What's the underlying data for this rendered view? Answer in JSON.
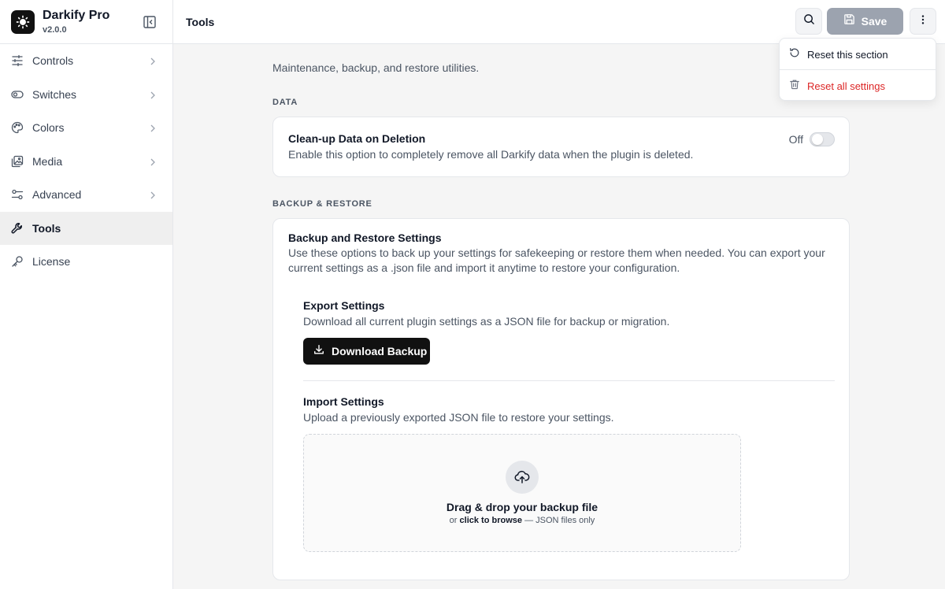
{
  "app": {
    "name": "Darkify Pro",
    "version": "v2.0.0"
  },
  "sidebar": {
    "items": [
      {
        "label": "Controls",
        "icon": "sliders-icon",
        "active": false
      },
      {
        "label": "Switches",
        "icon": "toggle-icon",
        "active": false
      },
      {
        "label": "Colors",
        "icon": "palette-icon",
        "active": false
      },
      {
        "label": "Media",
        "icon": "images-icon",
        "active": false
      },
      {
        "label": "Advanced",
        "icon": "settings-sliders-icon",
        "active": false
      },
      {
        "label": "Tools",
        "icon": "wrench-icon",
        "active": true
      },
      {
        "label": "License",
        "icon": "key-icon",
        "active": false
      }
    ]
  },
  "header": {
    "title": "Tools",
    "save_label": "Save"
  },
  "menu": {
    "reset_section": "Reset this section",
    "reset_all": "Reset all settings"
  },
  "main": {
    "description": "Maintenance, backup, and restore utilities.",
    "data_section": {
      "label": "DATA",
      "cleanup": {
        "title": "Clean-up Data on Deletion",
        "description": "Enable this option to completely remove all Darkify data when the plugin is deleted.",
        "toggle_state": "Off"
      }
    },
    "backup_section": {
      "label": "BACKUP & RESTORE",
      "title": "Backup and Restore Settings",
      "description": "Use these options to back up your settings for safekeeping or restore them when needed. You can export your current settings as a .json file and import it anytime to restore your configuration.",
      "export": {
        "title": "Export Settings",
        "description": "Download all current plugin settings as a JSON file for backup or migration.",
        "button_label": "Download Backup"
      },
      "import": {
        "title": "Import Settings",
        "description": "Upload a previously exported JSON file to restore your settings.",
        "dropzone_title": "Drag & drop your backup file",
        "dropzone_prefix": "or",
        "dropzone_link": "click to browse",
        "dropzone_suffix": "— JSON files only"
      }
    }
  },
  "colors": {
    "danger": "#dc2626",
    "primary_button": "#111111",
    "save_disabled": "#9ca3af"
  }
}
